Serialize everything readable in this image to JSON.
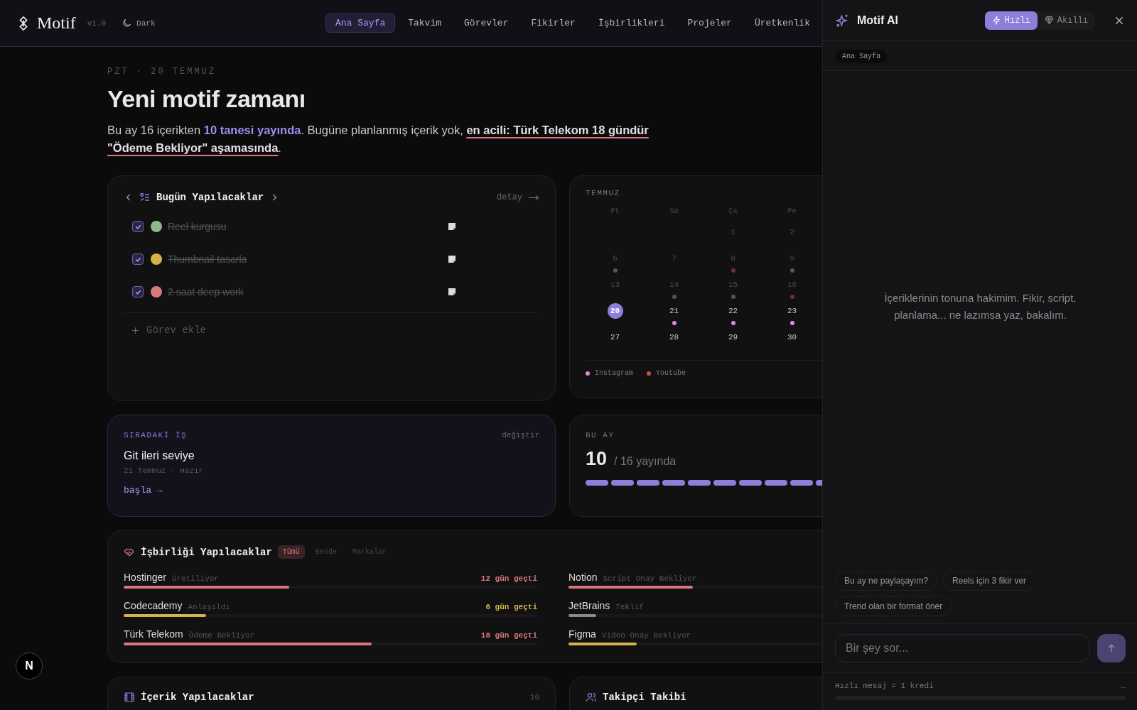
{
  "header": {
    "logo": "Motif",
    "version": "v1.0",
    "theme_toggle": "Dark",
    "nav": [
      {
        "label": "Ana Sayfa",
        "selected": true
      },
      {
        "label": "Takvim",
        "selected": false
      },
      {
        "label": "Görevler",
        "selected": false
      },
      {
        "label": "Fikirler",
        "selected": false
      },
      {
        "label": "İşbirlikleri",
        "selected": false
      },
      {
        "label": "Projeler",
        "selected": false
      },
      {
        "label": "Üretkenlik",
        "selected": false
      }
    ]
  },
  "greeting": {
    "date": "PZT · 20 TEMMUZ",
    "title": "Yeni motif zamanı",
    "summary": [
      {
        "kind": "plain",
        "text": "Bu ay 16 içerikten "
      },
      {
        "kind": "highlight",
        "text": "10 tanesi yayında"
      },
      {
        "kind": "plain",
        "text": ". Bugüne planlanmış içerik yok, "
      },
      {
        "kind": "alert",
        "text": "en acili: Türk Telekom 18 gündür \"Ödeme Bekliyor\" aşamasında"
      },
      {
        "kind": "plain",
        "text": "."
      }
    ]
  },
  "tasks_card": {
    "title": "Bugün Yapılacaklar",
    "detail": "detay",
    "add": "Görev ekle",
    "tasks": [
      {
        "text": "Reel kurgusu",
        "checked": true,
        "color": "#8fb98b"
      },
      {
        "text": "Thumbnail tasarla",
        "checked": true,
        "color": "#d4b448"
      },
      {
        "text": "2 saat deep work",
        "checked": true,
        "color": "#d97a7a"
      }
    ]
  },
  "calendar": {
    "month": "TEMMUZ",
    "weekdays": [
      "Pt",
      "Sa",
      "Ça",
      "Pe"
    ],
    "weeks": [
      [
        {
          "kind": "blank"
        },
        {
          "kind": "blank"
        },
        {
          "kind": "day",
          "label": "1",
          "past": true,
          "selected": false
        },
        {
          "kind": "day",
          "label": "2",
          "past": true,
          "selected": false
        }
      ],
      [
        {
          "kind": "day",
          "label": "6",
          "past": true,
          "selected": false,
          "color": "#6b4868"
        },
        {
          "kind": "day",
          "label": "7",
          "past": true,
          "selected": false
        },
        {
          "kind": "day",
          "label": "8",
          "past": true,
          "selected": false,
          "color": "#6a3333"
        },
        {
          "kind": "day",
          "label": "9",
          "past": true,
          "selected": false,
          "color": "#6b4868"
        }
      ],
      [
        {
          "kind": "day",
          "label": "13",
          "past": true,
          "selected": false
        },
        {
          "kind": "day",
          "label": "14",
          "past": true,
          "selected": false,
          "color": "#6b4868"
        },
        {
          "kind": "day",
          "label": "15",
          "past": true,
          "selected": false,
          "color": "#6b4868"
        },
        {
          "kind": "day",
          "label": "16",
          "past": true,
          "selected": false,
          "color": "#6a3333"
        }
      ],
      [
        {
          "kind": "day",
          "label": "20",
          "past": false,
          "selected": true
        },
        {
          "kind": "day",
          "label": "21",
          "past": false,
          "selected": false,
          "color": "#e48bd8"
        },
        {
          "kind": "day",
          "label": "22",
          "past": false,
          "selected": false,
          "color": "#e48bd8"
        },
        {
          "kind": "day",
          "label": "23",
          "past": false,
          "selected": false,
          "color": "#e48bd8"
        }
      ],
      [
        {
          "kind": "day",
          "label": "27",
          "past": false,
          "selected": false
        },
        {
          "kind": "day",
          "label": "28",
          "past": false,
          "selected": false
        },
        {
          "kind": "day",
          "label": "29",
          "past": false,
          "selected": false
        },
        {
          "kind": "day",
          "label": "30",
          "past": false,
          "selected": false
        }
      ]
    ],
    "legend": [
      {
        "label": "Instagram",
        "color": "#e48bd8"
      },
      {
        "label": "Youtube",
        "color": "#c4504a"
      }
    ]
  },
  "next_task": {
    "label": "SIRADAKİ İŞ",
    "change": "değiştir",
    "title": "Git ileri seviye",
    "meta": "21 Temmuz · Hazır",
    "action": "başla →"
  },
  "month_stats": {
    "label": "BU AY",
    "count": "10",
    "total": "/ 16 yayında",
    "segments": [
      {
        "filled": true
      },
      {
        "filled": true
      },
      {
        "filled": true
      },
      {
        "filled": true
      },
      {
        "filled": true
      },
      {
        "filled": true
      },
      {
        "filled": true
      },
      {
        "filled": true
      },
      {
        "filled": true
      },
      {
        "filled": true
      }
    ]
  },
  "collabs": {
    "title": "İşbirliği Yapılacaklar",
    "filters": [
      {
        "label": "Tümü",
        "selected": true
      },
      {
        "label": "Bende",
        "selected": false
      },
      {
        "label": "Markalar",
        "selected": false
      }
    ],
    "columns": [
      [
        {
          "brand": "Hostinger",
          "stage": "Üretiliyor",
          "overdue": "12 gün geçti",
          "color": "#d9777a",
          "level": 0.4
        },
        {
          "brand": "Codecademy",
          "stage": "Anlaşıldı",
          "overdue": "6 gün geçti",
          "color": "#d4b448",
          "level": 0.2
        },
        {
          "brand": "Türk Telekom",
          "stage": "Ödeme Bekliyor",
          "overdue": "18 gün geçti",
          "color": "#d9777a",
          "level": 0.6
        }
      ],
      [
        {
          "brand": "Notion",
          "stage": "Script Onay Bekliyor",
          "color": "#d9777a",
          "level": 0.3
        },
        {
          "brand": "JetBrains",
          "stage": "Teklif",
          "color": "#8a8a8e",
          "level": 0.067
        },
        {
          "brand": "Figma",
          "stage": "Video Onay Bekliyor",
          "color": "#d4b448",
          "level": 0.165
        }
      ]
    ]
  },
  "content_todo": {
    "title": "İçerik Yapılacaklar",
    "count": "10"
  },
  "followers": {
    "title": "Takipçi Takibi"
  },
  "dev_badge": "N",
  "assistant": {
    "title": "Motif AI",
    "modes": [
      {
        "kind": "fast",
        "label": "Hızlı",
        "selected": true
      },
      {
        "kind": "smart",
        "label": "Akıllı",
        "selected": false
      }
    ],
    "context": "Ana Sayfa",
    "empty_message": "İçeriklerinin tonuna hakimim. Fikir, script, planlama... ne lazımsa yaz, bakalım.",
    "suggestions": [
      "Bu ay ne paylaşayım?",
      "Reels için 3 fikir ver",
      "Trend olan bir format öner"
    ],
    "input": {
      "placeholder": "Bir şey sor..."
    },
    "credit_note": "Hızlı mesaj = 1 kredi",
    "credit_value": "…",
    "credit": {
      "level": 0
    }
  }
}
